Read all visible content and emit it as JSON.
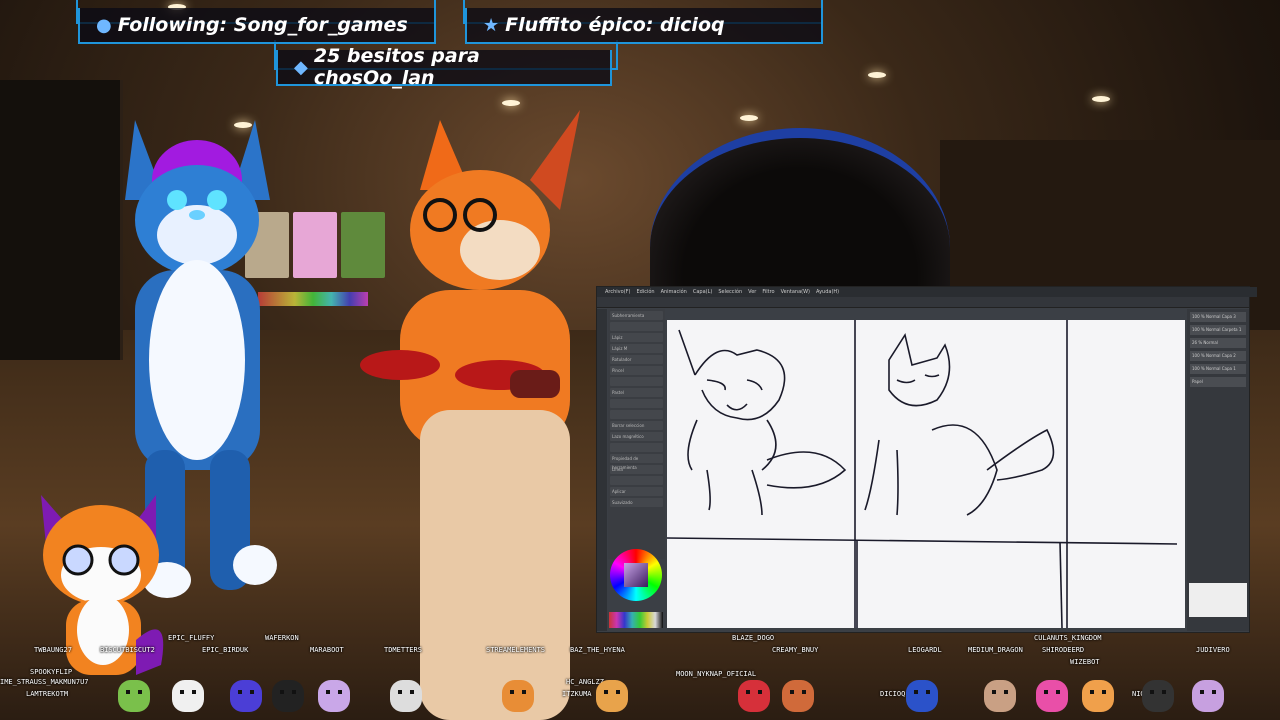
{
  "alerts": {
    "following": {
      "icon": "user-icon",
      "text": "Following: Song_for_games"
    },
    "fluffito": {
      "icon": "star-icon",
      "text": "Fluffito épico: dicioq"
    },
    "besitos": {
      "icon": "diamond-icon",
      "text": "25 besitos para chosOo_lan"
    }
  },
  "drawing_app": {
    "menu": [
      "Archivo(F)",
      "Edición",
      "Animación",
      "Capa(L)",
      "Selección",
      "Ver",
      "Filtro",
      "Ventana(W)",
      "Ayuda(H)"
    ],
    "left_panel_rows": [
      "Subherramienta",
      "",
      "Lápiz",
      "Lápiz M",
      "Rotulador",
      "Pincel",
      "",
      "Pastel",
      "",
      "",
      "Borrar seleccion",
      "Lazo magnético",
      "",
      "Propiedad de herramienta",
      "Línea",
      "",
      "Aplicar",
      "Suavizado"
    ],
    "layers": [
      "100 % Normal Capa 3",
      "100 % Normal Carpeta 1",
      "26 % Normal",
      "100 % Normal Capa 2",
      "100 % Normal Capa 1",
      "Papel"
    ]
  },
  "chatters": [
    {
      "name": "TWBAUNG27"
    },
    {
      "name": "BISCUTBISCUT2"
    },
    {
      "name": "EPIC_FLUFFY"
    },
    {
      "name": "EPIC_BIRDUK"
    },
    {
      "name": "WAFERKON"
    },
    {
      "name": "MARABOOT"
    },
    {
      "name": "TDMETTERS"
    },
    {
      "name": "STREAMELEMENTS"
    },
    {
      "name": "BAZ_THE_HYENA"
    },
    {
      "name": "BLAZE_DOGO"
    },
    {
      "name": "CREAMY_BNUY"
    },
    {
      "name": "LEOGARDL"
    },
    {
      "name": "MEDIUM_DRAGON"
    },
    {
      "name": "CULANUTS_KINGDOM"
    },
    {
      "name": "SHIRODEERD"
    },
    {
      "name": "WIZEBOT"
    },
    {
      "name": "JUDIVERO"
    },
    {
      "name": "SPOOKYFLIP"
    },
    {
      "name": "IME_STRAUSS_MAKMUN7U7"
    },
    {
      "name": "LAMTREKOTM"
    },
    {
      "name": "MOON_NYKNAP_OFICIAL"
    },
    {
      "name": "HC_ANGLZZ"
    },
    {
      "name": "ITZKUMA"
    },
    {
      "name": "DICIOQ"
    },
    {
      "name": "NIGHTBOT"
    }
  ],
  "colors": {
    "frame": "#1f95db",
    "follow_dot": "#ffd400"
  }
}
